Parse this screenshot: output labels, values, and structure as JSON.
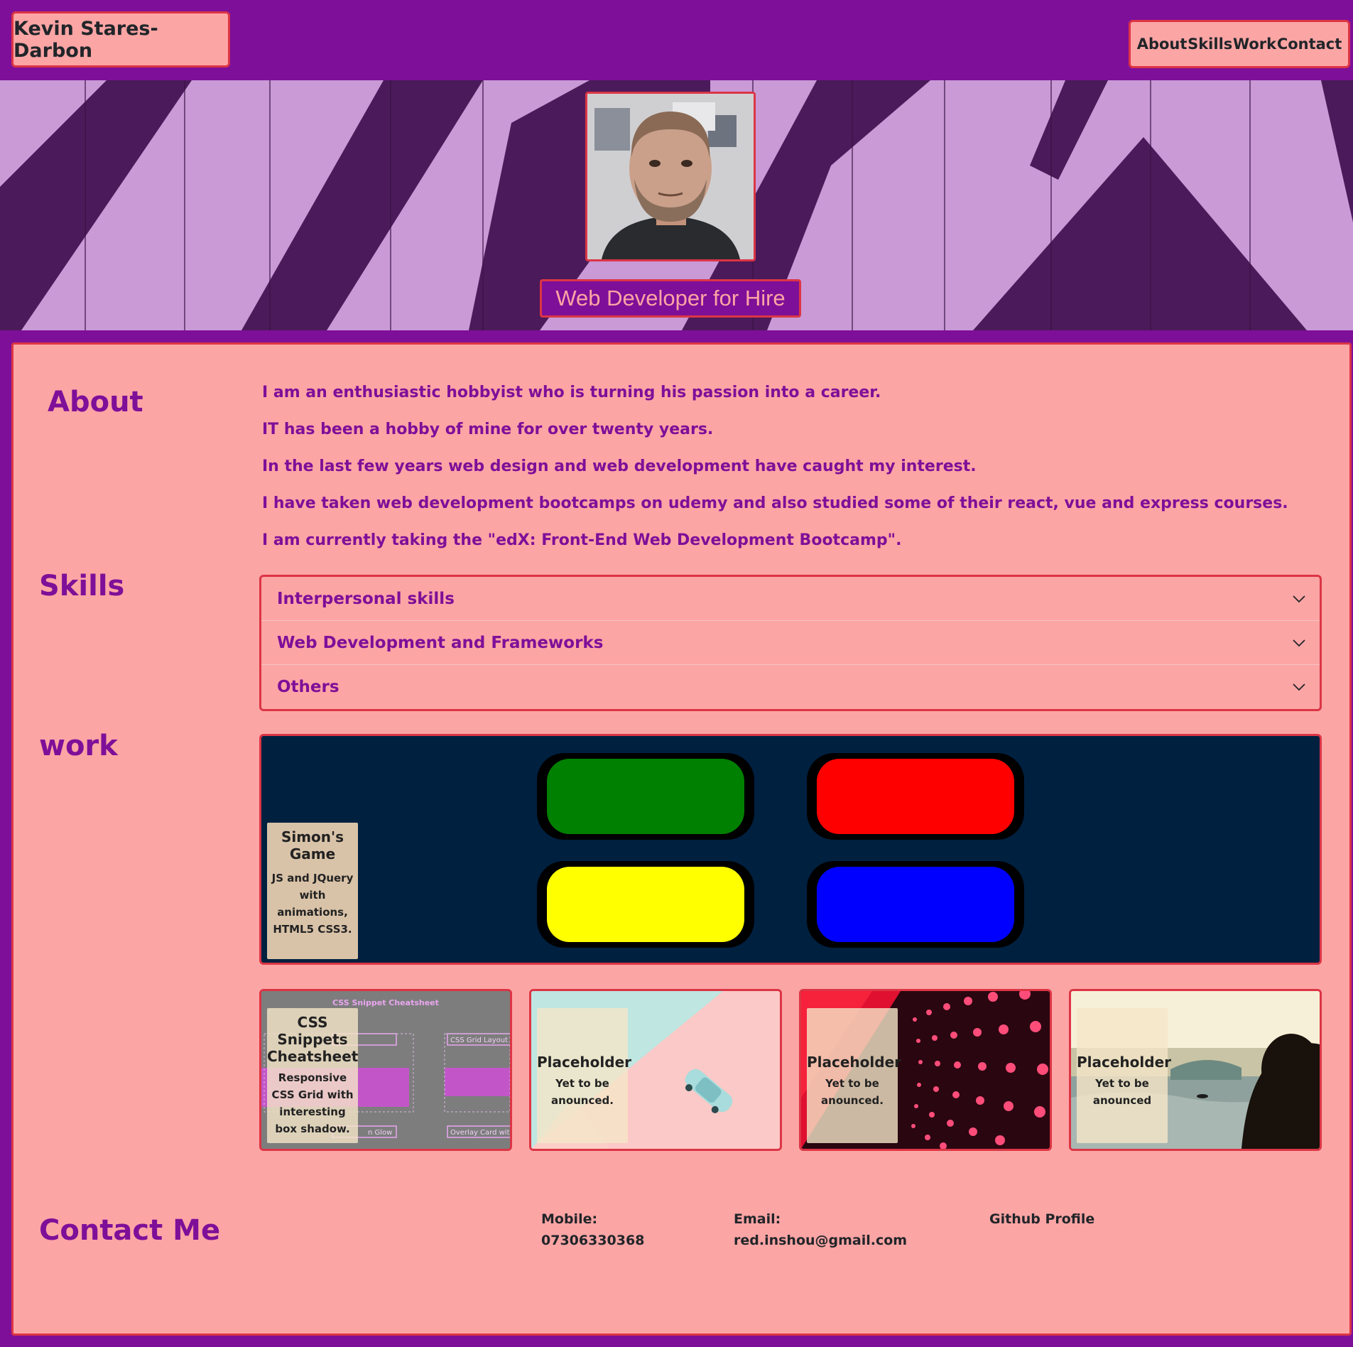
{
  "header": {
    "brand": "Kevin Stares-Darbon",
    "nav": [
      "About",
      "Skills",
      "Work",
      "Contact"
    ]
  },
  "hero": {
    "tagline": "Web Developer for Hire"
  },
  "about": {
    "title": "About",
    "paragraphs": [
      "I am an enthusiastic hobbyist who is turning his passion into a career.",
      "IT has been a hobby of mine for over twenty years.",
      "In the last few years web design and web development have caught my interest.",
      "I have taken web development bootcamps on udemy and also studied some of their react, vue and express courses.",
      "I am currently taking the \"edX: Front-End Web Development Bootcamp\"."
    ]
  },
  "skills": {
    "title": "Skills",
    "items": [
      "Interpersonal skills",
      "Web Development and Frameworks",
      "Others"
    ]
  },
  "work": {
    "title": "work",
    "featured": {
      "title": "Simon's Game",
      "description": "JS and JQuery with animations, HTML5 CSS3."
    },
    "screenshot_text": {
      "title": "CSS Snippet Cheatsheet",
      "grid": "CSS Grid Layout",
      "glow": "n Glow",
      "overlay": "Overlay Card with Title"
    },
    "cards": [
      {
        "title": "CSS Snippets Cheatsheet",
        "description": "Responsive CSS Grid with interesting box shadow."
      },
      {
        "title": "Placeholder",
        "description": "Yet to be anounced."
      },
      {
        "title": "Placeholder",
        "description": "Yet to be anounced."
      },
      {
        "title": "Placeholder",
        "description": "Yet to be anounced"
      }
    ]
  },
  "contact": {
    "title": "Contact Me",
    "mobile_label": "Mobile:",
    "mobile": "07306330368",
    "email_label": "Email:",
    "email": "red.inshou@gmail.com",
    "github": "Github Profile"
  },
  "colors": {
    "page_bg": "#7e0f98",
    "panel_bg": "#fca5a5",
    "border": "#dc3545",
    "heading": "#7e0f98",
    "simon_bg": "#002040",
    "simon_green": "#008000",
    "simon_red": "#ff0000",
    "simon_yellow": "#ffff00",
    "simon_blue": "#0000ff"
  }
}
